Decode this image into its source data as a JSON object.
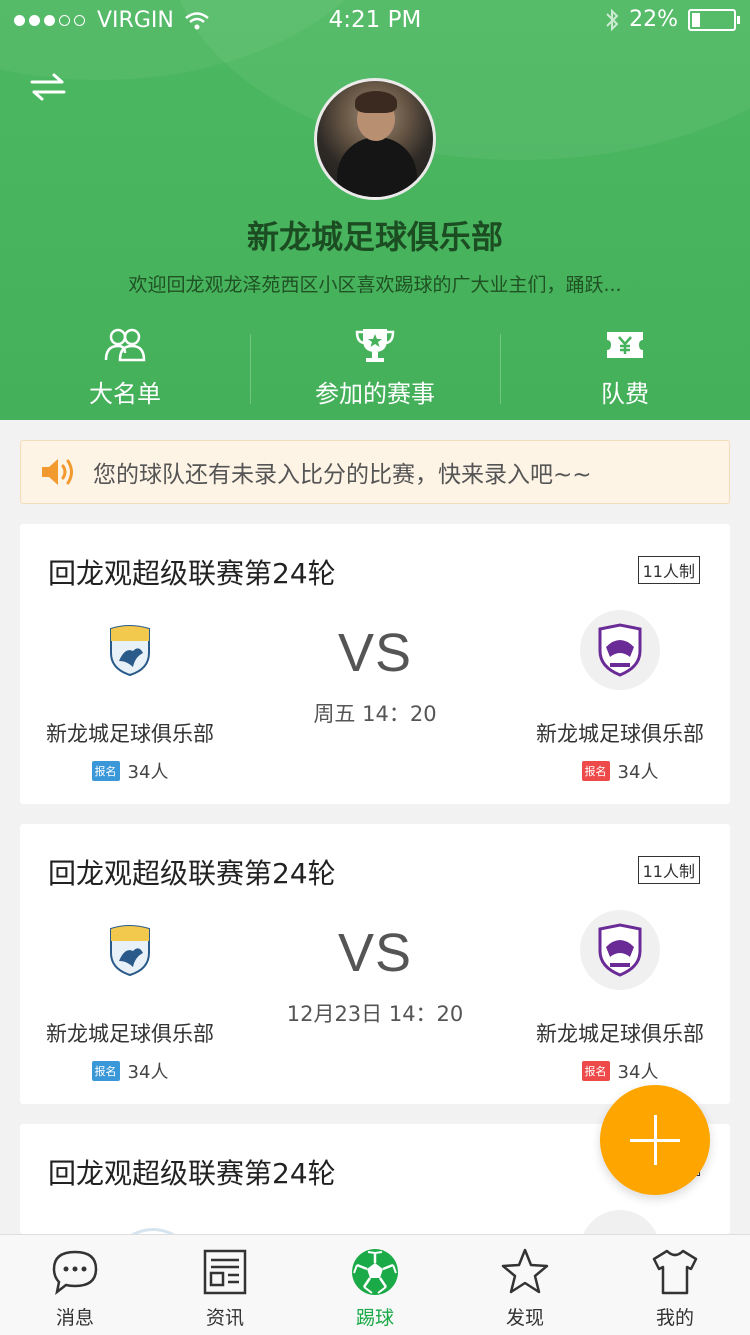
{
  "status_bar": {
    "carrier": "VIRGIN",
    "time": "4:21 PM",
    "battery": "22%"
  },
  "club": {
    "name": "新龙城足球俱乐部",
    "description": "欢迎回龙观龙泽苑西区小区喜欢踢球的广大业主们，踊跃..."
  },
  "menu": [
    {
      "label": "大名单",
      "icon": "people-icon"
    },
    {
      "label": "参加的赛事",
      "icon": "trophy-icon"
    },
    {
      "label": "队费",
      "icon": "ticket-yuan-icon"
    }
  ],
  "notice": {
    "text": "您的球队还有未录入比分的比赛，快来录入吧~~"
  },
  "matches": [
    {
      "title": "回龙观超级联赛第24轮",
      "format": "11人制",
      "home": {
        "name": "新龙城足球俱乐部",
        "badge": "报名",
        "count": "34人"
      },
      "away": {
        "name": "新龙城足球俱乐部",
        "badge": "报名",
        "count": "34人"
      },
      "vs": "VS",
      "time": "周五 14：20"
    },
    {
      "title": "回龙观超级联赛第24轮",
      "format": "11人制",
      "home": {
        "name": "新龙城足球俱乐部",
        "badge": "报名",
        "count": "34人"
      },
      "away": {
        "name": "新龙城足球俱乐部",
        "badge": "报名",
        "count": "34人"
      },
      "vs": "VS",
      "time": "12月23日 14：20"
    },
    {
      "title": "回龙观超级联赛第24轮"
    }
  ],
  "tabs": [
    {
      "label": "消息",
      "icon": "chat-bubble-icon"
    },
    {
      "label": "资讯",
      "icon": "news-icon"
    },
    {
      "label": "踢球",
      "icon": "soccer-ball-icon"
    },
    {
      "label": "发现",
      "icon": "star-icon"
    },
    {
      "label": "我的",
      "icon": "jersey-icon"
    }
  ],
  "colors": {
    "header_green": "#4cb861",
    "accent_orange": "#ffa500",
    "active_tab": "#1aaa48"
  }
}
